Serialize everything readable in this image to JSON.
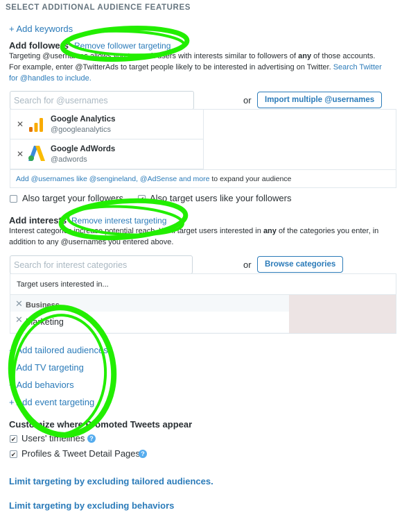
{
  "section_title": "SELECT ADDITIONAL AUDIENCE FEATURES",
  "add_keywords": "+ Add keywords",
  "followers": {
    "label": "Add followers",
    "remove_link": "Remove follower targeting",
    "desc_1": "Targeting @usernames allows you to reach users with interests similar to followers of",
    "desc_any": "any",
    "desc_2": "of those accounts. For example, enter @TwitterAds to target people likely to be interested in advertising on Twitter.",
    "desc_link": "Search Twitter for @handles to include.",
    "search_placeholder": "Search for @usernames",
    "or": "or",
    "import_button": "Import multiple @usernames",
    "accounts": [
      {
        "name": "Google Analytics",
        "handle": "@googleanalytics",
        "icon": "google-analytics-logo"
      },
      {
        "name": "Google AdWords",
        "handle": "@adwords",
        "icon": "google-adwords-logo"
      }
    ],
    "suggest_link": "Add @usernames like @sengineland, @AdSense and more",
    "suggest_tail": "to expand your audience",
    "also_followers": "Also target your followers",
    "also_like_followers": "Also target users like your followers",
    "also_followers_checked": false,
    "also_like_followers_checked": true
  },
  "interests": {
    "label": "Add interests",
    "remove_link": "Remove interest targeting",
    "desc_1": "Interest categories increase potential reach. We'll target users interested in",
    "desc_any": "any",
    "desc_2": "of the categories you enter, in addition to any @usernames you entered above.",
    "search_placeholder": "Search for interest categories",
    "or": "or",
    "browse_button": "Browse categories",
    "target_header": "Target users interested in...",
    "category": "Business",
    "subcategory": "Marketing"
  },
  "more_links": [
    "+ Add tailored audiences",
    "+ Add TV targeting",
    "+ Add behaviors",
    "+ Add event targeting"
  ],
  "placement": {
    "title": "Customize where Promoted Tweets appear",
    "options": [
      {
        "label": "Users' timelines",
        "checked": true
      },
      {
        "label": "Profiles & Tweet Detail Pages",
        "checked": true
      }
    ]
  },
  "exclude_links": [
    "Limit targeting by excluding tailored audiences.",
    "Limit targeting by excluding behaviors"
  ],
  "colors": {
    "link": "#2b7bb9",
    "highlight": "#22ee00"
  }
}
